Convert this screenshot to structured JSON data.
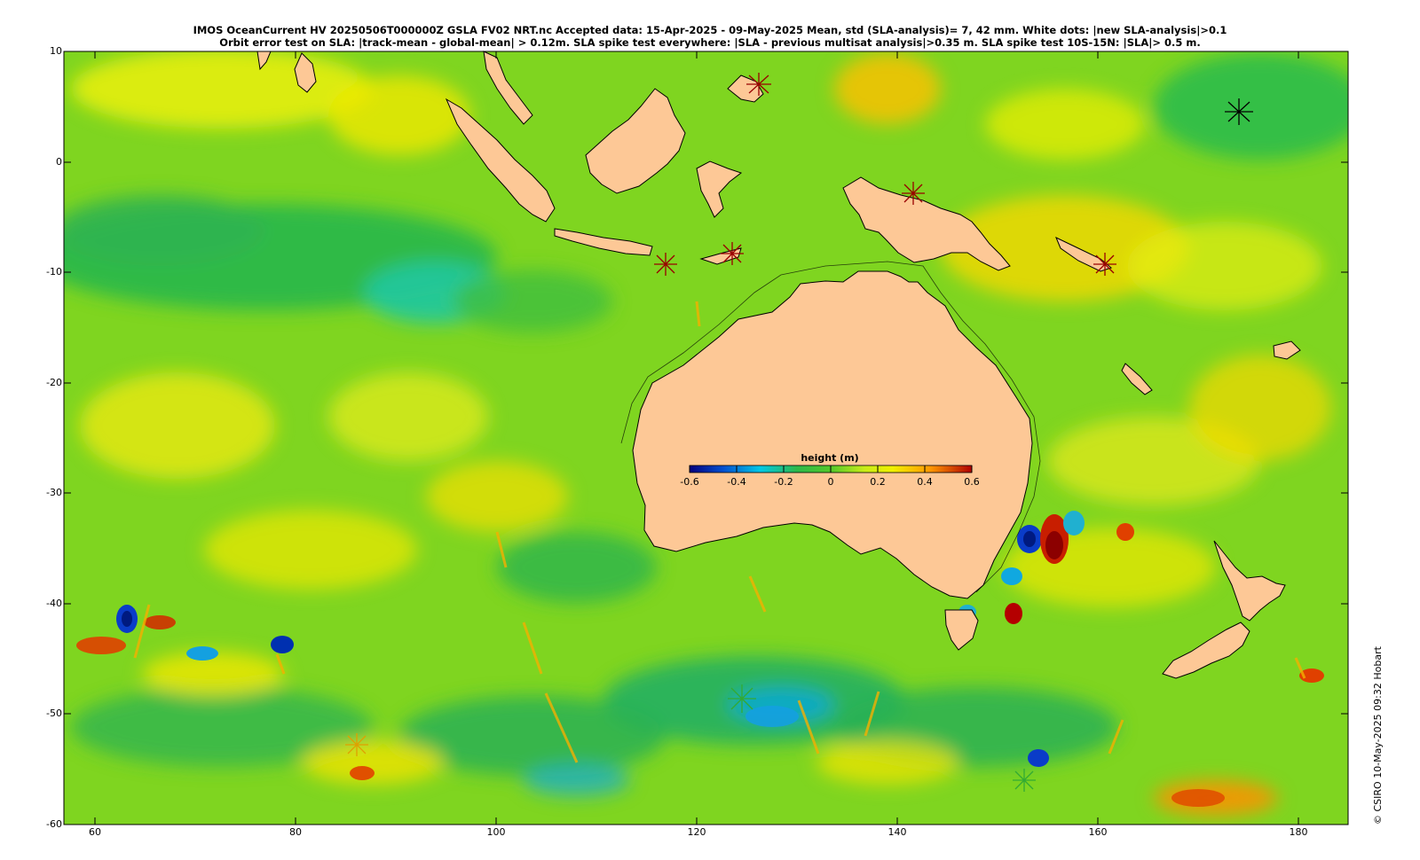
{
  "title": {
    "line1": "IMOS OceanCurrent HV 20250506T000000Z GSLA FV02 NRT.nc  Accepted data: 15-Apr-2025 - 09-May-2025 Mean, std (SLA-analysis)= 7, 42 mm. White dots: |new SLA-analysis|>0.1",
    "line2": "Orbit error test on SLA: |track-mean  - global-mean| > 0.12m.  SLA spike test everywhere: |SLA - previous multisat analysis|>0.35 m. SLA spike test 10S-15N: |SLA|> 0.5 m."
  },
  "axes": {
    "lon_ticks": [
      "60",
      "80",
      "100",
      "120",
      "140",
      "160",
      "180"
    ],
    "lat_ticks": [
      "10",
      "0",
      "-10",
      "-20",
      "-30",
      "-40",
      "-50",
      "-60"
    ]
  },
  "colorbar": {
    "title": "height (m)",
    "ticks": [
      "-0.6",
      "-0.4",
      "-0.2",
      "0",
      "0.2",
      "0.4",
      "0.6"
    ],
    "colors": [
      "#00007f",
      "#0050d0",
      "#00c8e6",
      "#2db84a",
      "#9be619",
      "#f0f000",
      "#ffb400",
      "#ff5a00",
      "#b00000"
    ]
  },
  "credit": "© CSIRO 10-May-2025 09:32 Hobart",
  "colors": {
    "land": "#fdc896",
    "ocean_base": "#7fd520",
    "coast": "#000000"
  }
}
